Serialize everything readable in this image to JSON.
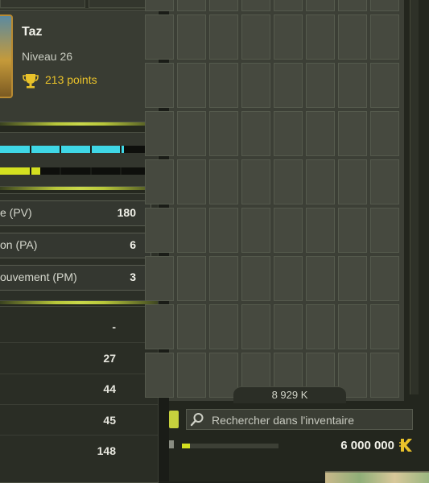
{
  "character": {
    "name": "Taz",
    "level": "Niveau 26",
    "points": "213 points"
  },
  "bars": {
    "health_fraction": 0.83,
    "energy_fraction": 0.27
  },
  "stats": [
    {
      "label": "e (PV)",
      "value": "180"
    },
    {
      "label": "on (PA)",
      "value": "6"
    },
    {
      "label": "ouvement (PM)",
      "value": "3"
    }
  ],
  "characteristics": [
    {
      "value": "-"
    },
    {
      "value": "27"
    },
    {
      "value": "44"
    },
    {
      "value": "45"
    },
    {
      "value": "148"
    }
  ],
  "inventory": {
    "weight": "8 929 K",
    "search_placeholder": "Rechercher dans l'inventaire",
    "pods_fraction": 0.08,
    "kamas": "6 000 000",
    "kamas_icon": "kamas-icon"
  },
  "colors": {
    "accent_green": "#c9d84a",
    "health_cyan": "#3fd7e6",
    "energy_yellow": "#d4e020",
    "gold": "#e9c22a"
  }
}
